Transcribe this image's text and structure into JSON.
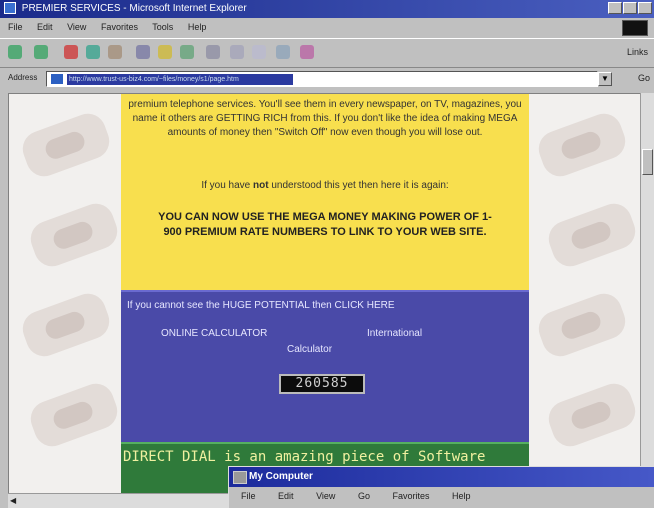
{
  "browser": {
    "title": "PREMIER SERVICES - Microsoft Internet Explorer",
    "menu": [
      "File",
      "Edit",
      "View",
      "Favorites",
      "Tools",
      "Help"
    ],
    "links_label": "Links",
    "address_label": "Address",
    "address_url": "http://www.trust-us-biz4.com/~files/money/s1/page.htm",
    "go_label": "Go"
  },
  "page": {
    "yellow": {
      "para1": "premium telephone services. You'll see them in every newspaper, on TV, magazines, you name it others are GETTING RICH from this. If you don't like the idea of making MEGA amounts of money then \"Switch Off\" now even though you will lose out.",
      "para2_pre": "If you have ",
      "para2_bold": "not",
      "para2_post": " understood this yet then here it is again:",
      "headline": "YOU CAN NOW USE THE MEGA MONEY MAKING POWER OF 1-900 PREMIUM RATE NUMBERS TO LINK TO YOUR WEB SITE."
    },
    "blue": {
      "cta": "If you cannot see the HUGE POTENTIAL then CLICK HERE",
      "online_calculator": "ONLINE CALCULATOR",
      "international": "International",
      "calculator": "Calculator",
      "counter": "260585"
    },
    "green": {
      "text": "DIRECT DIAL is an amazing piece of Software"
    }
  },
  "my_computer": {
    "title": "My Computer",
    "menu": [
      "File",
      "Edit",
      "View",
      "Go",
      "Favorites",
      "Help"
    ]
  }
}
